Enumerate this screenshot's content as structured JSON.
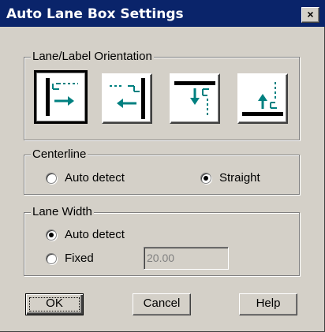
{
  "window": {
    "title": "Auto Lane Box Settings",
    "close_label": "×"
  },
  "orientation": {
    "label": "Lane/Label Orientation",
    "options": [
      {
        "name": "left-lane-right-arrow",
        "selected": true
      },
      {
        "name": "right-lane-left-arrow",
        "selected": false
      },
      {
        "name": "top-lane-down-arrow",
        "selected": false
      },
      {
        "name": "bottom-lane-up-arrow",
        "selected": false
      }
    ]
  },
  "centerline": {
    "label": "Centerline",
    "auto_label": "Auto detect",
    "straight_label": "Straight",
    "selected": "straight"
  },
  "lane_width": {
    "label": "Lane Width",
    "auto_label": "Auto detect",
    "fixed_label": "Fixed",
    "selected": "auto",
    "fixed_value": "20.00"
  },
  "buttons": {
    "ok": "OK",
    "cancel": "Cancel",
    "help": "Help"
  },
  "colors": {
    "titlebar": "#0a246a",
    "face": "#d4d0c8",
    "icon_teal": "#008080"
  }
}
